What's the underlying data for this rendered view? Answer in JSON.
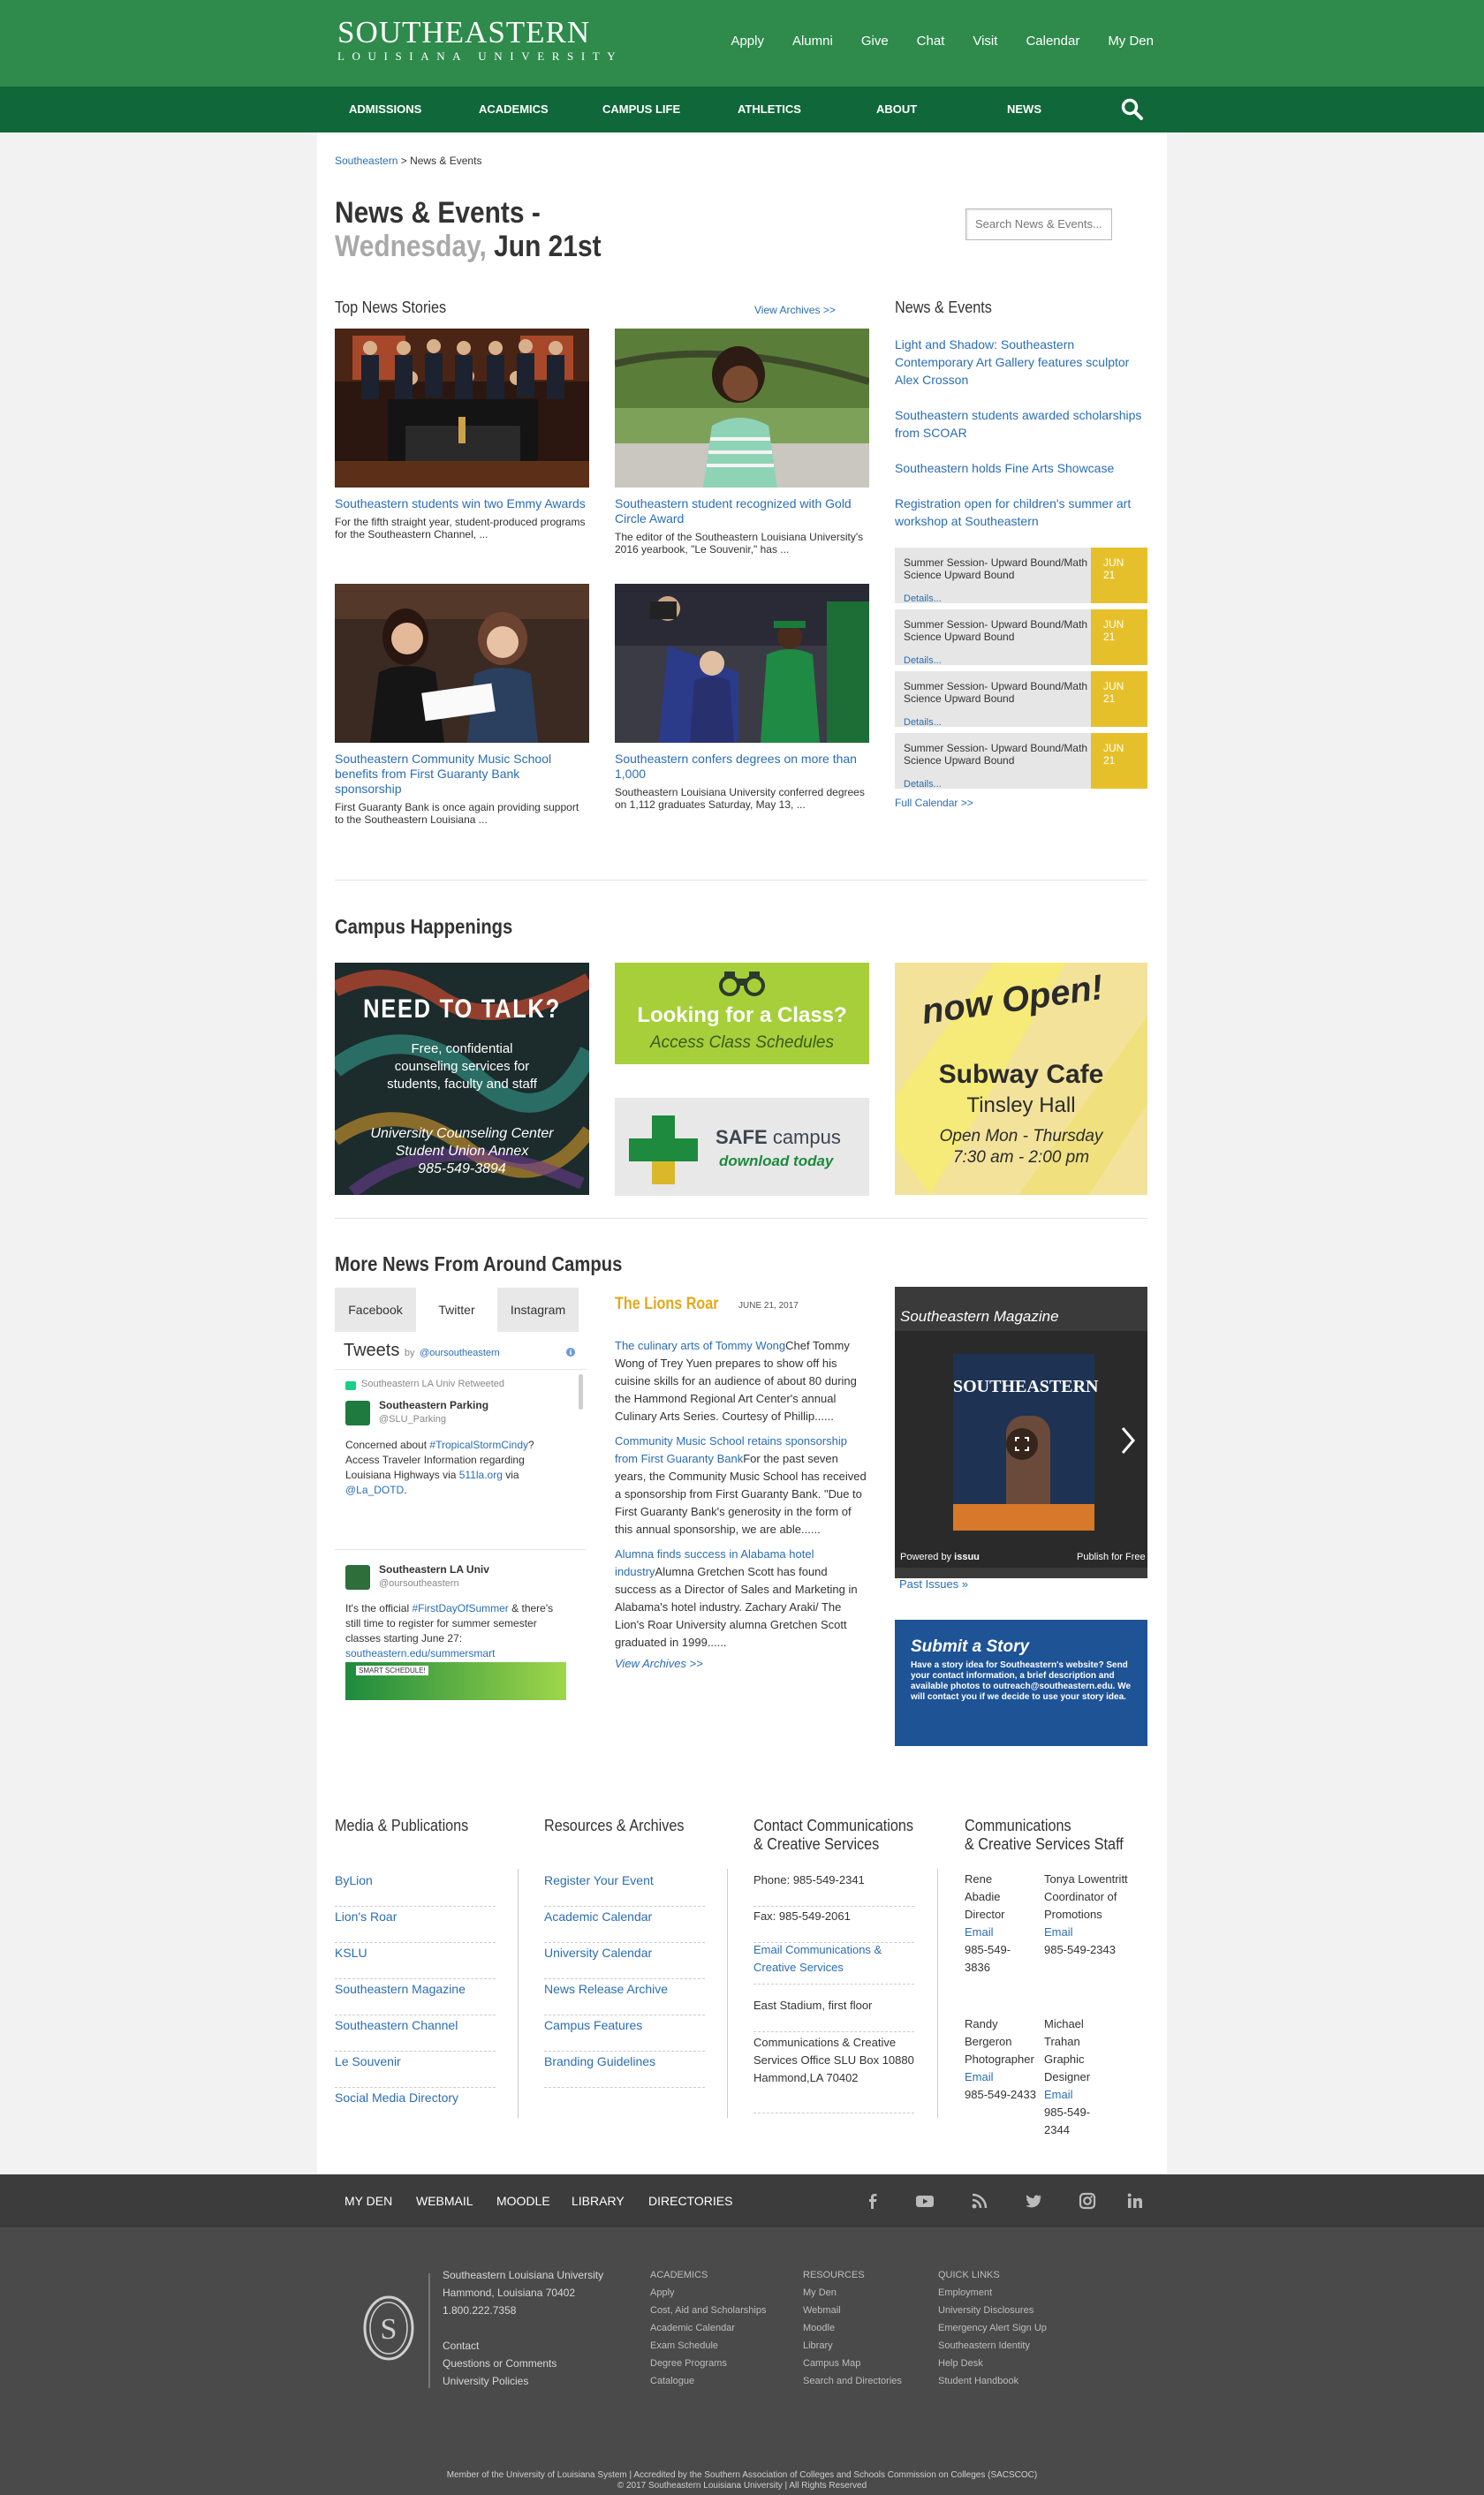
{
  "header": {
    "logo_line1": "SOUTHEASTERN",
    "logo_line2": "LOUISIANA UNIVERSITY",
    "top_links": [
      "Apply",
      "Alumni",
      "Give",
      "Chat",
      "Visit",
      "Calendar",
      "My Den"
    ],
    "nav": [
      "ADMISSIONS",
      "ACADEMICS",
      "CAMPUS LIFE",
      "ATHLETICS",
      "ABOUT",
      "NEWS"
    ]
  },
  "breadcrumb": {
    "home": "Southeastern",
    "sep": " > ",
    "current": "News & Events"
  },
  "page_title": {
    "line1": "News & Events -",
    "day": "Wednesday,",
    "date": "Jun 21st"
  },
  "search": {
    "placeholder": "Search News & Events..."
  },
  "top_news": {
    "title": "Top News Stories",
    "archives": "View Archives >>",
    "stories": [
      {
        "title": "Southeastern students win two Emmy Awards",
        "text": "For the fifth straight year, student-produced programs for the Southeastern Channel, ..."
      },
      {
        "title": "Southeastern student recognized with Gold Circle Award",
        "text": "The editor of the Southeastern Louisiana University's 2016 yearbook, \"Le Souvenir,\" has ..."
      },
      {
        "title": "Southeastern Community Music School benefits from First Guaranty Bank sponsorship",
        "text": "First Guaranty Bank is once again providing support to the Southeastern Louisiana ..."
      },
      {
        "title": "Southeastern confers degrees on more than 1,000",
        "text": "Southeastern Louisiana University conferred degrees on 1,112 graduates Saturday, May 13, ..."
      }
    ]
  },
  "news_events": {
    "title": "News & Events",
    "links": [
      "Light and Shadow: Southeastern Contemporary Art Gallery features sculptor Alex Crosson",
      "Southeastern students awarded scholarships from SCOAR",
      "Southeastern holds Fine Arts Showcase",
      "Registration open for children's summer art workshop at Southeastern"
    ],
    "events": [
      {
        "title": "Summer Session- Upward Bound/Math Science Upward Bound",
        "details": "Details...",
        "month": "JUN",
        "day": "21"
      },
      {
        "title": "Summer Session- Upward Bound/Math Science Upward Bound",
        "details": "Details...",
        "month": "JUN",
        "day": "21"
      },
      {
        "title": "Summer Session- Upward Bound/Math Science Upward Bound",
        "details": "Details...",
        "month": "JUN",
        "day": "21"
      },
      {
        "title": "Summer Session- Upward Bound/Math Science Upward Bound",
        "details": "Details...",
        "month": "JUN",
        "day": "21"
      }
    ],
    "full_calendar": "Full Calendar >>"
  },
  "campus_happenings": {
    "title": "Campus Happenings",
    "talk": {
      "headline": "NEED TO TALK?",
      "sub": "Free, confidential counseling services for students, faculty and staff",
      "center": "University Counseling Center",
      "place": "Student Union Annex",
      "phone": "985-549-3894"
    },
    "class": {
      "headline": "Looking for a Class?",
      "sub": "Access Class Schedules"
    },
    "safe": {
      "name1": "SAFE",
      "name2": "campus",
      "sub": "download today"
    },
    "subway": {
      "open": "now Open!",
      "name": "Subway Cafe",
      "hall": "Tinsley Hall",
      "hours1": "Open Mon - Thursday",
      "hours2": "7:30 am - 2:00 pm"
    }
  },
  "more_news": {
    "title": "More News From Around Campus",
    "tabs": [
      "Facebook",
      "Twitter",
      "Instagram"
    ],
    "tweets": {
      "header": "Tweets",
      "by": "by",
      "handle": "@oursoutheastern",
      "retweeted": "Southeastern LA Univ Retweeted",
      "t1_name": "Southeastern Parking",
      "t1_handle": "@SLU_Parking",
      "t1_a": "Concerned about ",
      "t1_tag": "#TropicalStormCindy",
      "t1_b": "? Access Traveler Information regarding Louisiana Highways via ",
      "t1_link": "511la.org",
      "t1_c": " via ",
      "t1_link2": "@La_DOTD",
      "t1_d": ".",
      "t2_name": "Southeastern LA Univ",
      "t2_handle": "@oursoutheastern",
      "t2_a": "It's the official ",
      "t2_tag": "#FirstDayOfSummer",
      "t2_b": " & there's still time to register for summer semester classes starting June 27: ",
      "t2_link": "southeastern.edu/summersmart",
      "t2_img": "SMART SCHEDULE!"
    },
    "lions_roar": {
      "title": "The Lions Roar",
      "date": "JUNE 21, 2017",
      "items": [
        {
          "link": "The culinary arts of Tommy Wong",
          "text": "Chef Tommy Wong of Trey Yuen prepares to show off his cuisine skills for an audience of about 80 during the Hammond Regional Art Center's annual Culinary Arts Series. Courtesy of Phillip......"
        },
        {
          "link": "Community Music School retains sponsorship from First Guaranty Bank",
          "text": "For the past seven years, the Community Music School has received a sponsorship from First Guaranty Bank. \"Due to First Guaranty Bank's generosity in the form of this annual sponsorship, we are able......"
        },
        {
          "link": "Alumna finds success in Alabama hotel industry",
          "text": "Alumna Gretchen Scott has found success as a Director of Sales and Marketing in Alabama's hotel industry. Zachary Araki/ The Lion's Roar University alumna Gretchen Scott graduated in 1999......"
        }
      ],
      "archives": "View Archives >>"
    },
    "magazine": {
      "title": "Southeastern Magazine",
      "cover": "SOUTHEASTERN",
      "powered": "Powered by",
      "issuu": "issuu",
      "publish": "Publish for Free",
      "past": "Past Issues »"
    },
    "submit": {
      "title": "Submit a Story",
      "text": "Have a story idea for Southeastern's website? Send your contact information, a brief description and available photos to outreach@southeastern.edu. We will contact you if we decide to use your story idea."
    }
  },
  "footer_cols": {
    "media": {
      "title": "Media & Publications",
      "items": [
        "ByLion",
        "Lion's Roar",
        "KSLU",
        "Southeastern Magazine",
        "Southeastern Channel",
        "Le Souvenir",
        "Social Media Directory"
      ]
    },
    "resources": {
      "title": "Resources & Archives",
      "items": [
        "Register Your Event",
        "Academic Calendar",
        "University Calendar",
        "News Release Archive",
        "Campus Features",
        "Branding Guidelines"
      ]
    },
    "contact": {
      "title1": "Contact Communications",
      "title2": "& Creative Services",
      "phone": "Phone: 985-549-2341",
      "fax": "Fax: 985-549-2061",
      "email": "Email Communications & Creative Services",
      "location": "East Stadium, first floor",
      "address": "Communications & Creative Services Office SLU Box 10880 Hammond,LA 70402"
    },
    "staff": {
      "title1": "Communications",
      "title2": "& Creative Services Staff",
      "people": [
        {
          "name": "Rene Abadie",
          "role": "Director",
          "email": "Email",
          "phone": "985-549-3836"
        },
        {
          "name": "Tonya Lowentritt",
          "role": "Coordinator of Promotions",
          "email": "Email",
          "phone": "985-549-2343"
        },
        {
          "name": "Randy Bergeron",
          "role": "Photographer",
          "email": "Email",
          "phone": "985-549-2433"
        },
        {
          "name": "Michael Trahan",
          "role": "Graphic Designer",
          "email": "Email",
          "phone": "985-549-2344"
        }
      ]
    }
  },
  "footer_bar": {
    "links": [
      "MY DEN",
      "WEBMAIL",
      "MOODLE",
      "LIBRARY",
      "DIRECTORIES"
    ],
    "social": [
      "facebook-icon",
      "youtube-icon",
      "rss-icon",
      "twitter-icon",
      "instagram-icon",
      "linkedin-icon"
    ]
  },
  "bottom": {
    "address": [
      "Southeastern Louisiana University",
      "Hammond, Louisiana 70402",
      "1.800.222.7358"
    ],
    "contact": [
      "Contact",
      "Questions or Comments",
      "University Policies"
    ],
    "academics": {
      "title": "ACADEMICS",
      "items": [
        "Apply",
        "Cost, Aid and Scholarships",
        "Academic Calendar",
        "Exam Schedule",
        "Degree Programs",
        "Catalogue"
      ]
    },
    "resources": {
      "title": "RESOURCES",
      "items": [
        "My Den",
        "Webmail",
        "Moodle",
        "Library",
        "Campus Map",
        "Search and Directories"
      ]
    },
    "quick": {
      "title": "QUICK LINKS",
      "items": [
        "Employment",
        "University Disclosures",
        "Emergency Alert Sign Up",
        "Southeastern Identity",
        "Help Desk",
        "Student Handbook"
      ]
    },
    "legal1": "Member of the University of Louisiana System | Accredited by the Southern Association of Colleges and Schools Commission on Colleges (SACSCOC)",
    "legal2": "© 2017 Southeastern Louisiana University | All Rights Reserved"
  }
}
